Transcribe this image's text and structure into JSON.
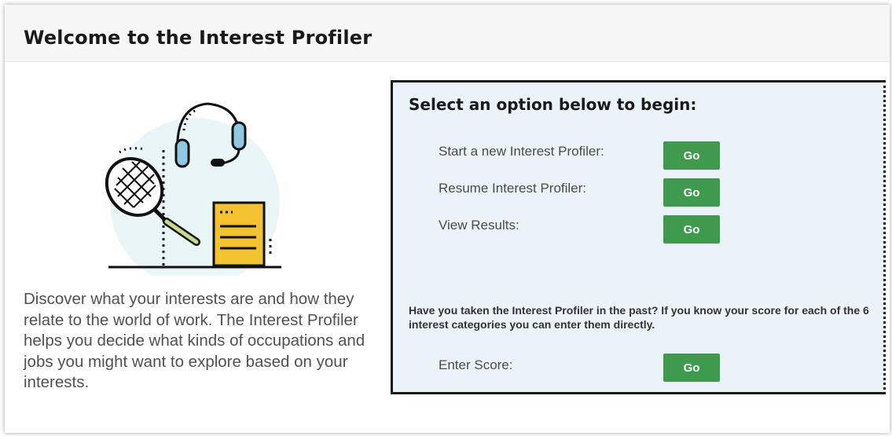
{
  "page": {
    "title": "Welcome to the Interest Profiler",
    "intro": "Discover what your interests are and how they relate to the world of work. The Interest Profiler helps you decide what kinds of occupations and jobs you might want to explore based on your interests."
  },
  "options": {
    "heading": "Select an option below to begin:",
    "items": [
      {
        "label": "Start a new Interest Profiler:",
        "button": "Go"
      },
      {
        "label": "Resume Interest Profiler:",
        "button": "Go"
      },
      {
        "label": "View Results:",
        "button": "Go"
      }
    ],
    "past_text": "Have you taken the Interest Profiler in the past? If you know your score for each of the 6 interest categories you can enter them directly.",
    "enter_score": {
      "label": "Enter Score:",
      "button": "Go"
    }
  },
  "icons": [
    "tennis-racket-icon",
    "headset-icon",
    "document-icon"
  ],
  "colors": {
    "button": "#3f9a4d",
    "panel": "#eaf3f7",
    "doc": "#f2c230",
    "headset": "#8fc8e0",
    "racket_handle": "#c9d98a"
  }
}
